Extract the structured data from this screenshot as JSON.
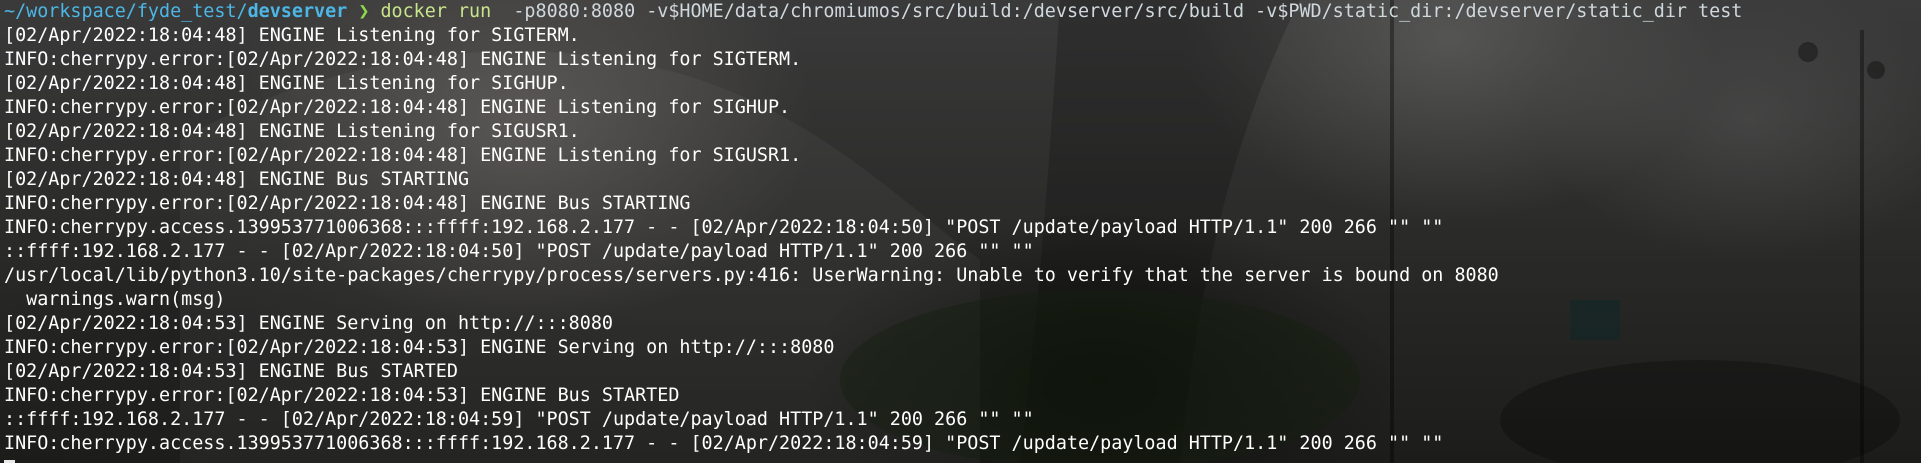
{
  "terminal": {
    "prompt": {
      "path_prefix": "~/workspace/fyde_test/",
      "cwd": "devserver",
      "chevron": " ❯ ",
      "command": "docker run",
      "args": "  -p8080:8080 -v$HOME/data/chromiumos/src/build:/devserver/src/build -v$PWD/static_dir:/devserver/static_dir test"
    },
    "output": [
      "[02/Apr/2022:18:04:48] ENGINE Listening for SIGTERM.",
      "INFO:cherrypy.error:[02/Apr/2022:18:04:48] ENGINE Listening for SIGTERM.",
      "[02/Apr/2022:18:04:48] ENGINE Listening for SIGHUP.",
      "INFO:cherrypy.error:[02/Apr/2022:18:04:48] ENGINE Listening for SIGHUP.",
      "[02/Apr/2022:18:04:48] ENGINE Listening for SIGUSR1.",
      "INFO:cherrypy.error:[02/Apr/2022:18:04:48] ENGINE Listening for SIGUSR1.",
      "[02/Apr/2022:18:04:48] ENGINE Bus STARTING",
      "INFO:cherrypy.error:[02/Apr/2022:18:04:48] ENGINE Bus STARTING",
      "INFO:cherrypy.access.139953771006368:::ffff:192.168.2.177 - - [02/Apr/2022:18:04:50] \"POST /update/payload HTTP/1.1\" 200 266 \"\" \"\"",
      "::ffff:192.168.2.177 - - [02/Apr/2022:18:04:50] \"POST /update/payload HTTP/1.1\" 200 266 \"\" \"\"",
      "/usr/local/lib/python3.10/site-packages/cherrypy/process/servers.py:416: UserWarning: Unable to verify that the server is bound on 8080",
      "  warnings.warn(msg)",
      "[02/Apr/2022:18:04:53] ENGINE Serving on http://:::8080",
      "INFO:cherrypy.error:[02/Apr/2022:18:04:53] ENGINE Serving on http://:::8080",
      "[02/Apr/2022:18:04:53] ENGINE Bus STARTED",
      "INFO:cherrypy.error:[02/Apr/2022:18:04:53] ENGINE Bus STARTED",
      "::ffff:192.168.2.177 - - [02/Apr/2022:18:04:59] \"POST /update/payload HTTP/1.1\" 200 266 \"\" \"\"",
      "INFO:cherrypy.access.139953771006368:::ffff:192.168.2.177 - - [02/Apr/2022:18:04:59] \"POST /update/payload HTTP/1.1\" 200 266 \"\" \"\""
    ]
  },
  "colors": {
    "path": "#4cb7e6",
    "chevron": "#8fd94a",
    "command": "#c7e58a",
    "text": "#ffffff",
    "cursor": "#e9e9e9"
  }
}
